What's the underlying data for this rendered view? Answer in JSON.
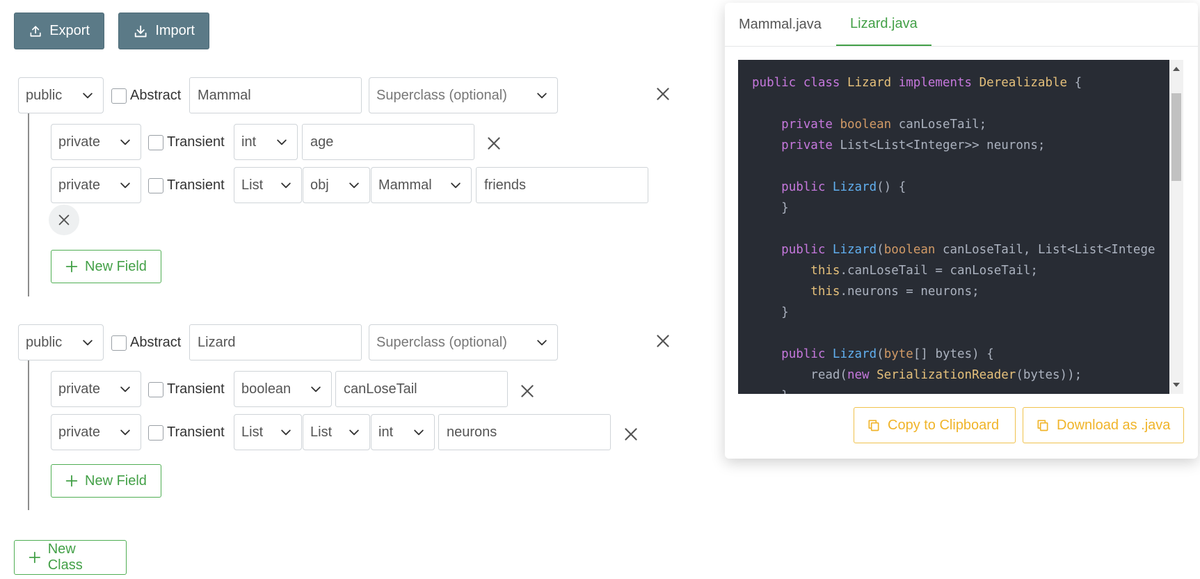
{
  "toolbar": {
    "export_label": "Export",
    "import_label": "Import"
  },
  "classes": [
    {
      "visibility": "public",
      "abstract_label": "Abstract",
      "name": "Mammal",
      "superclass_placeholder": "Superclass (optional)",
      "fields": [
        {
          "visibility": "private",
          "transient_label": "Transient",
          "types": [
            "int"
          ],
          "name": "age"
        },
        {
          "visibility": "private",
          "transient_label": "Transient",
          "types": [
            "List",
            "obj",
            "Mammal"
          ],
          "name": "friends"
        }
      ],
      "new_field_label": "New Field"
    },
    {
      "visibility": "public",
      "abstract_label": "Abstract",
      "name": "Lizard",
      "superclass_placeholder": "Superclass (optional)",
      "fields": [
        {
          "visibility": "private",
          "transient_label": "Transient",
          "types": [
            "boolean"
          ],
          "name": "canLoseTail"
        },
        {
          "visibility": "private",
          "transient_label": "Transient",
          "types": [
            "List",
            "List",
            "int"
          ],
          "name": "neurons"
        }
      ],
      "new_field_label": "New Field"
    }
  ],
  "new_class_label": "New Class",
  "preview": {
    "tabs": [
      {
        "label": "Mammal.java",
        "active": false
      },
      {
        "label": "Lizard.java",
        "active": true
      }
    ],
    "code_lines": [
      "public class Lizard implements Derealizable {",
      "",
      "    private boolean canLoseTail;",
      "    private List<List<Integer>> neurons;",
      "",
      "    public Lizard() {",
      "    }",
      "",
      "    public Lizard(boolean canLoseTail, List<List<Intege",
      "        this.canLoseTail = canLoseTail;",
      "        this.neurons = neurons;",
      "    }",
      "",
      "    public Lizard(byte[] bytes) {",
      "        read(new SerializationReader(bytes));",
      "    }"
    ],
    "copy_label": "Copy to Clipboard",
    "download_label": "Download as .java"
  },
  "colors": {
    "primary_dark": "#5b7a87",
    "success_green": "#43a047",
    "warning_yellow": "#f0b429",
    "code_bg": "#282c34"
  }
}
